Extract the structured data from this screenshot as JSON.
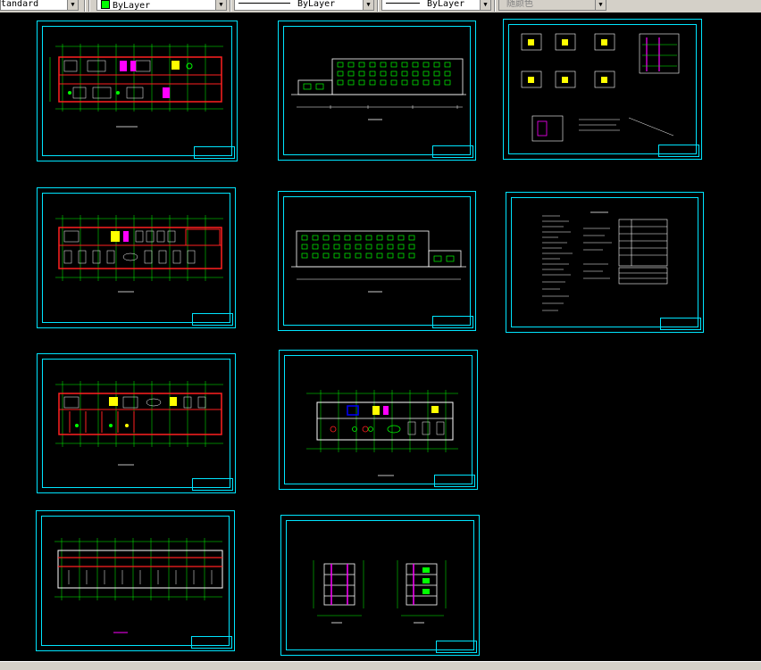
{
  "toolbar": {
    "text_style": "tandard",
    "layer_color": "ByLayer",
    "linetype": "ByLayer",
    "lineweight": "ByLayer",
    "plot_style": "随颜色",
    "swatch_color": "#00ff00"
  },
  "colors": {
    "background": "#000000",
    "frame": "#00e5ff",
    "wall": "#ff2020",
    "dimension": "#00ff00",
    "highlight": "#ffff00",
    "accent": "#ff00ff",
    "text": "#ffffff"
  },
  "sheets": [
    {
      "id": "floor-plan-1"
    },
    {
      "id": "elevation-1"
    },
    {
      "id": "details"
    },
    {
      "id": "floor-plan-2"
    },
    {
      "id": "elevation-2"
    },
    {
      "id": "design-notes"
    },
    {
      "id": "floor-plan-3"
    },
    {
      "id": "floor-plan-4"
    },
    {
      "id": "roof-plan"
    },
    {
      "id": "sections"
    }
  ]
}
